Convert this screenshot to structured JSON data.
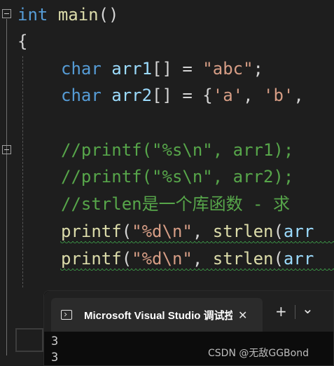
{
  "code": {
    "l1": {
      "kw": "int",
      "fn": "main",
      "rest": "()"
    },
    "l2": {
      "brace": "{"
    },
    "l3": {
      "kw": "char",
      "var": "arr1",
      "p1": "[] = ",
      "str": "\"abc\"",
      "p2": ";"
    },
    "l4": {
      "kw": "char",
      "var": "arr2",
      "p1": "[] = {",
      "s1": "'a'",
      "p2": ", ",
      "s2": "'b'",
      "p3": ","
    },
    "l6": {
      "comment": "//printf(\"%s\\n\", arr1);"
    },
    "l7": {
      "comment": "//printf(\"%s\\n\", arr2);"
    },
    "l8": {
      "comment": "//strlen是一个库函数 - 求"
    },
    "l9": {
      "fn": "printf",
      "p1": "(",
      "str": "\"%d\\n\"",
      "p2": ", ",
      "fn2": "strlen",
      "p3": "(",
      "var": "arr"
    },
    "l10": {
      "fn": "printf",
      "p1": "(",
      "str": "\"%d\\n\"",
      "p2": ", ",
      "fn2": "strlen",
      "p3": "(",
      "var": "arr"
    }
  },
  "terminal": {
    "tab_title": "Microsoft Visual Studio 调试控",
    "close_glyph": "✕",
    "new_tab_glyph": "+",
    "dropdown_glyph": "⌄",
    "output": [
      "3",
      "3"
    ]
  },
  "watermark": "CSDN @无敌GGBond",
  "icons": [
    "fold-collapse-icon",
    "terminal-app-icon",
    "close-icon",
    "plus-icon",
    "chevron-down-icon"
  ]
}
